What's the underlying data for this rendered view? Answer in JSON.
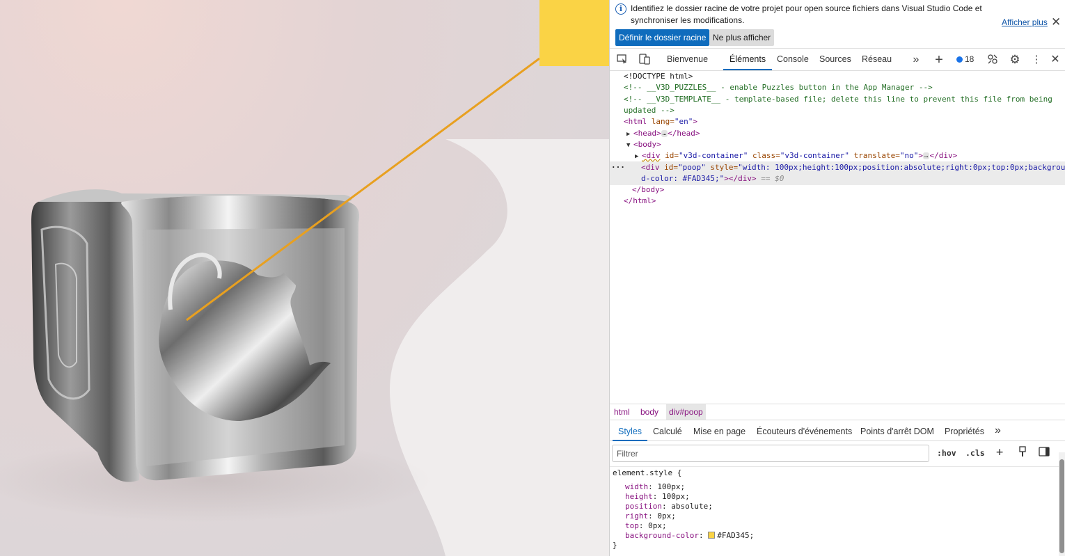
{
  "viewport": {
    "accent_color": "#FAD345",
    "line_color": "#E8A020"
  },
  "infobar": {
    "message": "Identifiez le dossier racine de votre projet pour open source fichiers dans Visual Studio Code et synchroniser les modifications.",
    "learn_more": "Afficher plus",
    "set_root_button": "Définir le dossier racine",
    "dont_show_button": "Ne plus afficher"
  },
  "tabs": {
    "welcome": "Bienvenue",
    "elements": "Éléments",
    "console": "Console",
    "sources": "Sources",
    "network": "Réseau",
    "issues_count": "18"
  },
  "dom": {
    "doctype": "<!DOCTYPE html>",
    "comment1": "<!-- __V3D_PUZZLES__ - enable Puzzles button in the App Manager -->",
    "comment2a": "<!-- __V3D_TEMPLATE__ - template-based file; delete this line to prevent this file from being",
    "comment2b": "updated -->",
    "html_open_tag": "<html",
    "html_lang_attr": " lang=",
    "html_lang_val": "\"en\"",
    "gt": ">",
    "head": "<head>",
    "head_close": "</head>",
    "body": "<body>",
    "div_open": "<div",
    "div_id_attr": " id=",
    "div1_id_val": "\"v3d-container\"",
    "div1_class_attr": " class=",
    "div1_class_val": "\"v3d-container\"",
    "div1_translate_attr": " translate=",
    "div1_translate_val": "\"no\"",
    "div_close": "</div>",
    "div2_id_val": "\"poop\"",
    "div2_style_attr": " style=",
    "div2_style_val_a": "\"width: 100px;height:100px;position:absolute;right:0px;top:0px;backgrou",
    "div2_style_val_b": "d-color: #FAD345;\"",
    "eq_dollar": " == $0",
    "body_close": "</body>",
    "html_close": "</html>",
    "ellipsis": "…"
  },
  "breadcrumbs": [
    "html",
    "body",
    "div#poop"
  ],
  "subtabs": [
    "Styles",
    "Calculé",
    "Mise en page",
    "Écouteurs d'événements",
    "Points d'arrêt DOM",
    "Propriétés"
  ],
  "filter": {
    "placeholder": "Filtrer",
    "hov": ":hov",
    "cls": ".cls"
  },
  "styles": {
    "selector": "element.style {",
    "close": "}",
    "props": [
      {
        "name": "width",
        "value": "100px;"
      },
      {
        "name": "height",
        "value": "100px;"
      },
      {
        "name": "position",
        "value": "absolute;"
      },
      {
        "name": "right",
        "value": "0px;"
      },
      {
        "name": "top",
        "value": "0px;"
      },
      {
        "name": "background-color",
        "value": "#FAD345;"
      }
    ]
  }
}
